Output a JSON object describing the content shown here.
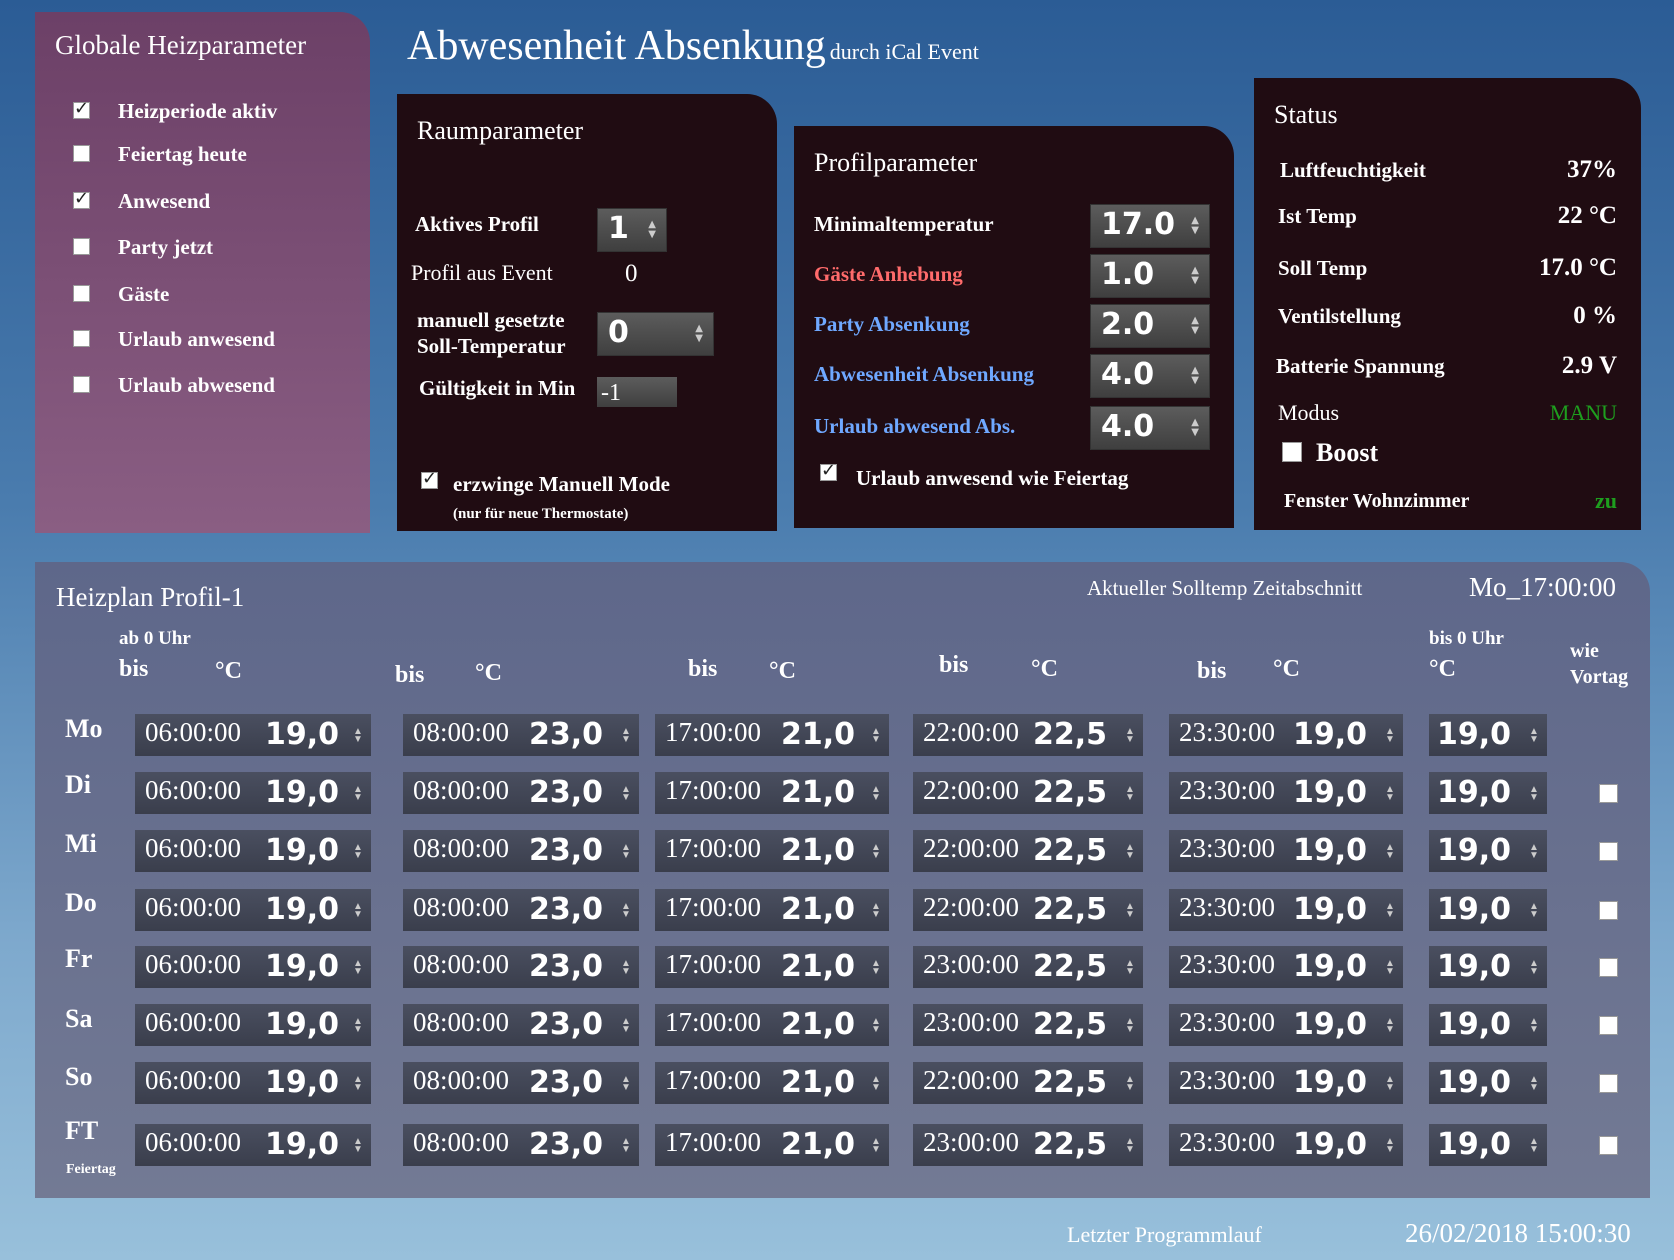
{
  "header": {
    "title": "Abwesenheit Absenkung",
    "subtitle": "durch iCal Event"
  },
  "global": {
    "title": "Globale Heizparameter",
    "items": [
      {
        "label": "Heizperiode aktiv",
        "checked": true
      },
      {
        "label": "Feiertag heute",
        "checked": false
      },
      {
        "label": "Anwesend",
        "checked": true
      },
      {
        "label": "Party jetzt",
        "checked": false
      },
      {
        "label": "Gäste",
        "checked": false
      },
      {
        "label": "Urlaub anwesend",
        "checked": false
      },
      {
        "label": "Urlaub abwesend",
        "checked": false
      }
    ]
  },
  "raum": {
    "title": "Raumparameter",
    "aktives_profil_label": "Aktives Profil",
    "aktives_profil_value": "1",
    "profil_event_label": "Profil aus Event",
    "profil_event_value": "0",
    "manuell_label_1": "manuell gesetzte",
    "manuell_label_2": "Soll-Temperatur",
    "manuell_value": "0",
    "gueltig_label": "Gültigkeit in Min",
    "gueltig_value": "-1",
    "erzwinge_label": "erzwinge Manuell Mode",
    "erzwinge_note": "(nur für neue Thermostate)",
    "erzwinge_checked": true
  },
  "profil": {
    "title": "Profilparameter",
    "params": [
      {
        "label": "Minimaltemperatur",
        "value": "17.0",
        "color": "#ffffff"
      },
      {
        "label": "Gäste Anhebung",
        "value": "1.0",
        "color": "#ff6b6b"
      },
      {
        "label": "Party Absenkung",
        "value": "2.0",
        "color": "#6fa8ff"
      },
      {
        "label": "Abwesenheit Absenkung",
        "value": "4.0",
        "color": "#6fa8ff"
      },
      {
        "label": "Urlaub abwesend Abs.",
        "value": "4.0",
        "color": "#6fa8ff"
      }
    ],
    "urlaub_feiertag_label": "Urlaub anwesend wie Feiertag",
    "urlaub_feiertag_checked": true
  },
  "status": {
    "title": "Status",
    "rows": [
      {
        "label": "Luftfeuchtigkeit",
        "value": "37%"
      },
      {
        "label": "Ist Temp",
        "value": "22 °C"
      },
      {
        "label": "Soll Temp",
        "value": "17.0 °C"
      },
      {
        "label": "Ventilstellung",
        "value": "0 %"
      },
      {
        "label": "Batterie Spannung",
        "value": "2.9 V"
      }
    ],
    "modus_label": "Modus",
    "modus_value": "MANU",
    "boost_label": "Boost",
    "fenster_label": "Fenster Wohnzimmer",
    "fenster_value": "zu",
    "green": "#1e9e1e"
  },
  "plan": {
    "title": "Heizplan Profil-1",
    "current_label": "Aktueller Solltemp Zeitabschnitt",
    "current_value": "Mo_17:00:00",
    "hdr_ab": "ab 0 Uhr",
    "hdr_bis": "bis",
    "hdr_c": "°C",
    "hdr_bis0": "bis 0 Uhr",
    "hdr_wie": "wie",
    "hdr_vortag": "Vortag",
    "feiertag_note": "Feiertag",
    "rows": [
      {
        "day": "Mo",
        "times": [
          "06:00:00",
          "08:00:00",
          "17:00:00",
          "22:00:00",
          "23:30:00"
        ],
        "temps": [
          "19,0",
          "23,0",
          "21,0",
          "22,5",
          "19,0",
          "19,0"
        ],
        "vortag": null
      },
      {
        "day": "Di",
        "times": [
          "06:00:00",
          "08:00:00",
          "17:00:00",
          "22:00:00",
          "23:30:00"
        ],
        "temps": [
          "19,0",
          "23,0",
          "21,0",
          "22,5",
          "19,0",
          "19,0"
        ],
        "vortag": false
      },
      {
        "day": "Mi",
        "times": [
          "06:00:00",
          "08:00:00",
          "17:00:00",
          "22:00:00",
          "23:30:00"
        ],
        "temps": [
          "19,0",
          "23,0",
          "21,0",
          "22,5",
          "19,0",
          "19,0"
        ],
        "vortag": false
      },
      {
        "day": "Do",
        "times": [
          "06:00:00",
          "08:00:00",
          "17:00:00",
          "22:00:00",
          "23:30:00"
        ],
        "temps": [
          "19,0",
          "23,0",
          "21,0",
          "22,5",
          "19,0",
          "19,0"
        ],
        "vortag": false
      },
      {
        "day": "Fr",
        "times": [
          "06:00:00",
          "08:00:00",
          "17:00:00",
          "23:00:00",
          "23:30:00"
        ],
        "temps": [
          "19,0",
          "23,0",
          "21,0",
          "22,5",
          "19,0",
          "19,0"
        ],
        "vortag": false
      },
      {
        "day": "Sa",
        "times": [
          "06:00:00",
          "08:00:00",
          "17:00:00",
          "23:00:00",
          "23:30:00"
        ],
        "temps": [
          "19,0",
          "23,0",
          "21,0",
          "22,5",
          "19,0",
          "19,0"
        ],
        "vortag": false
      },
      {
        "day": "So",
        "times": [
          "06:00:00",
          "08:00:00",
          "17:00:00",
          "22:00:00",
          "23:30:00"
        ],
        "temps": [
          "19,0",
          "23,0",
          "21,0",
          "22,5",
          "19,0",
          "19,0"
        ],
        "vortag": false
      },
      {
        "day": "FT",
        "times": [
          "06:00:00",
          "08:00:00",
          "17:00:00",
          "23:00:00",
          "23:30:00"
        ],
        "temps": [
          "19,0",
          "23,0",
          "21,0",
          "22,5",
          "19,0",
          "19,0"
        ],
        "vortag": false
      }
    ]
  },
  "footer": {
    "label": "Letzter Programmlauf",
    "value": "26/02/2018 15:00:30"
  }
}
